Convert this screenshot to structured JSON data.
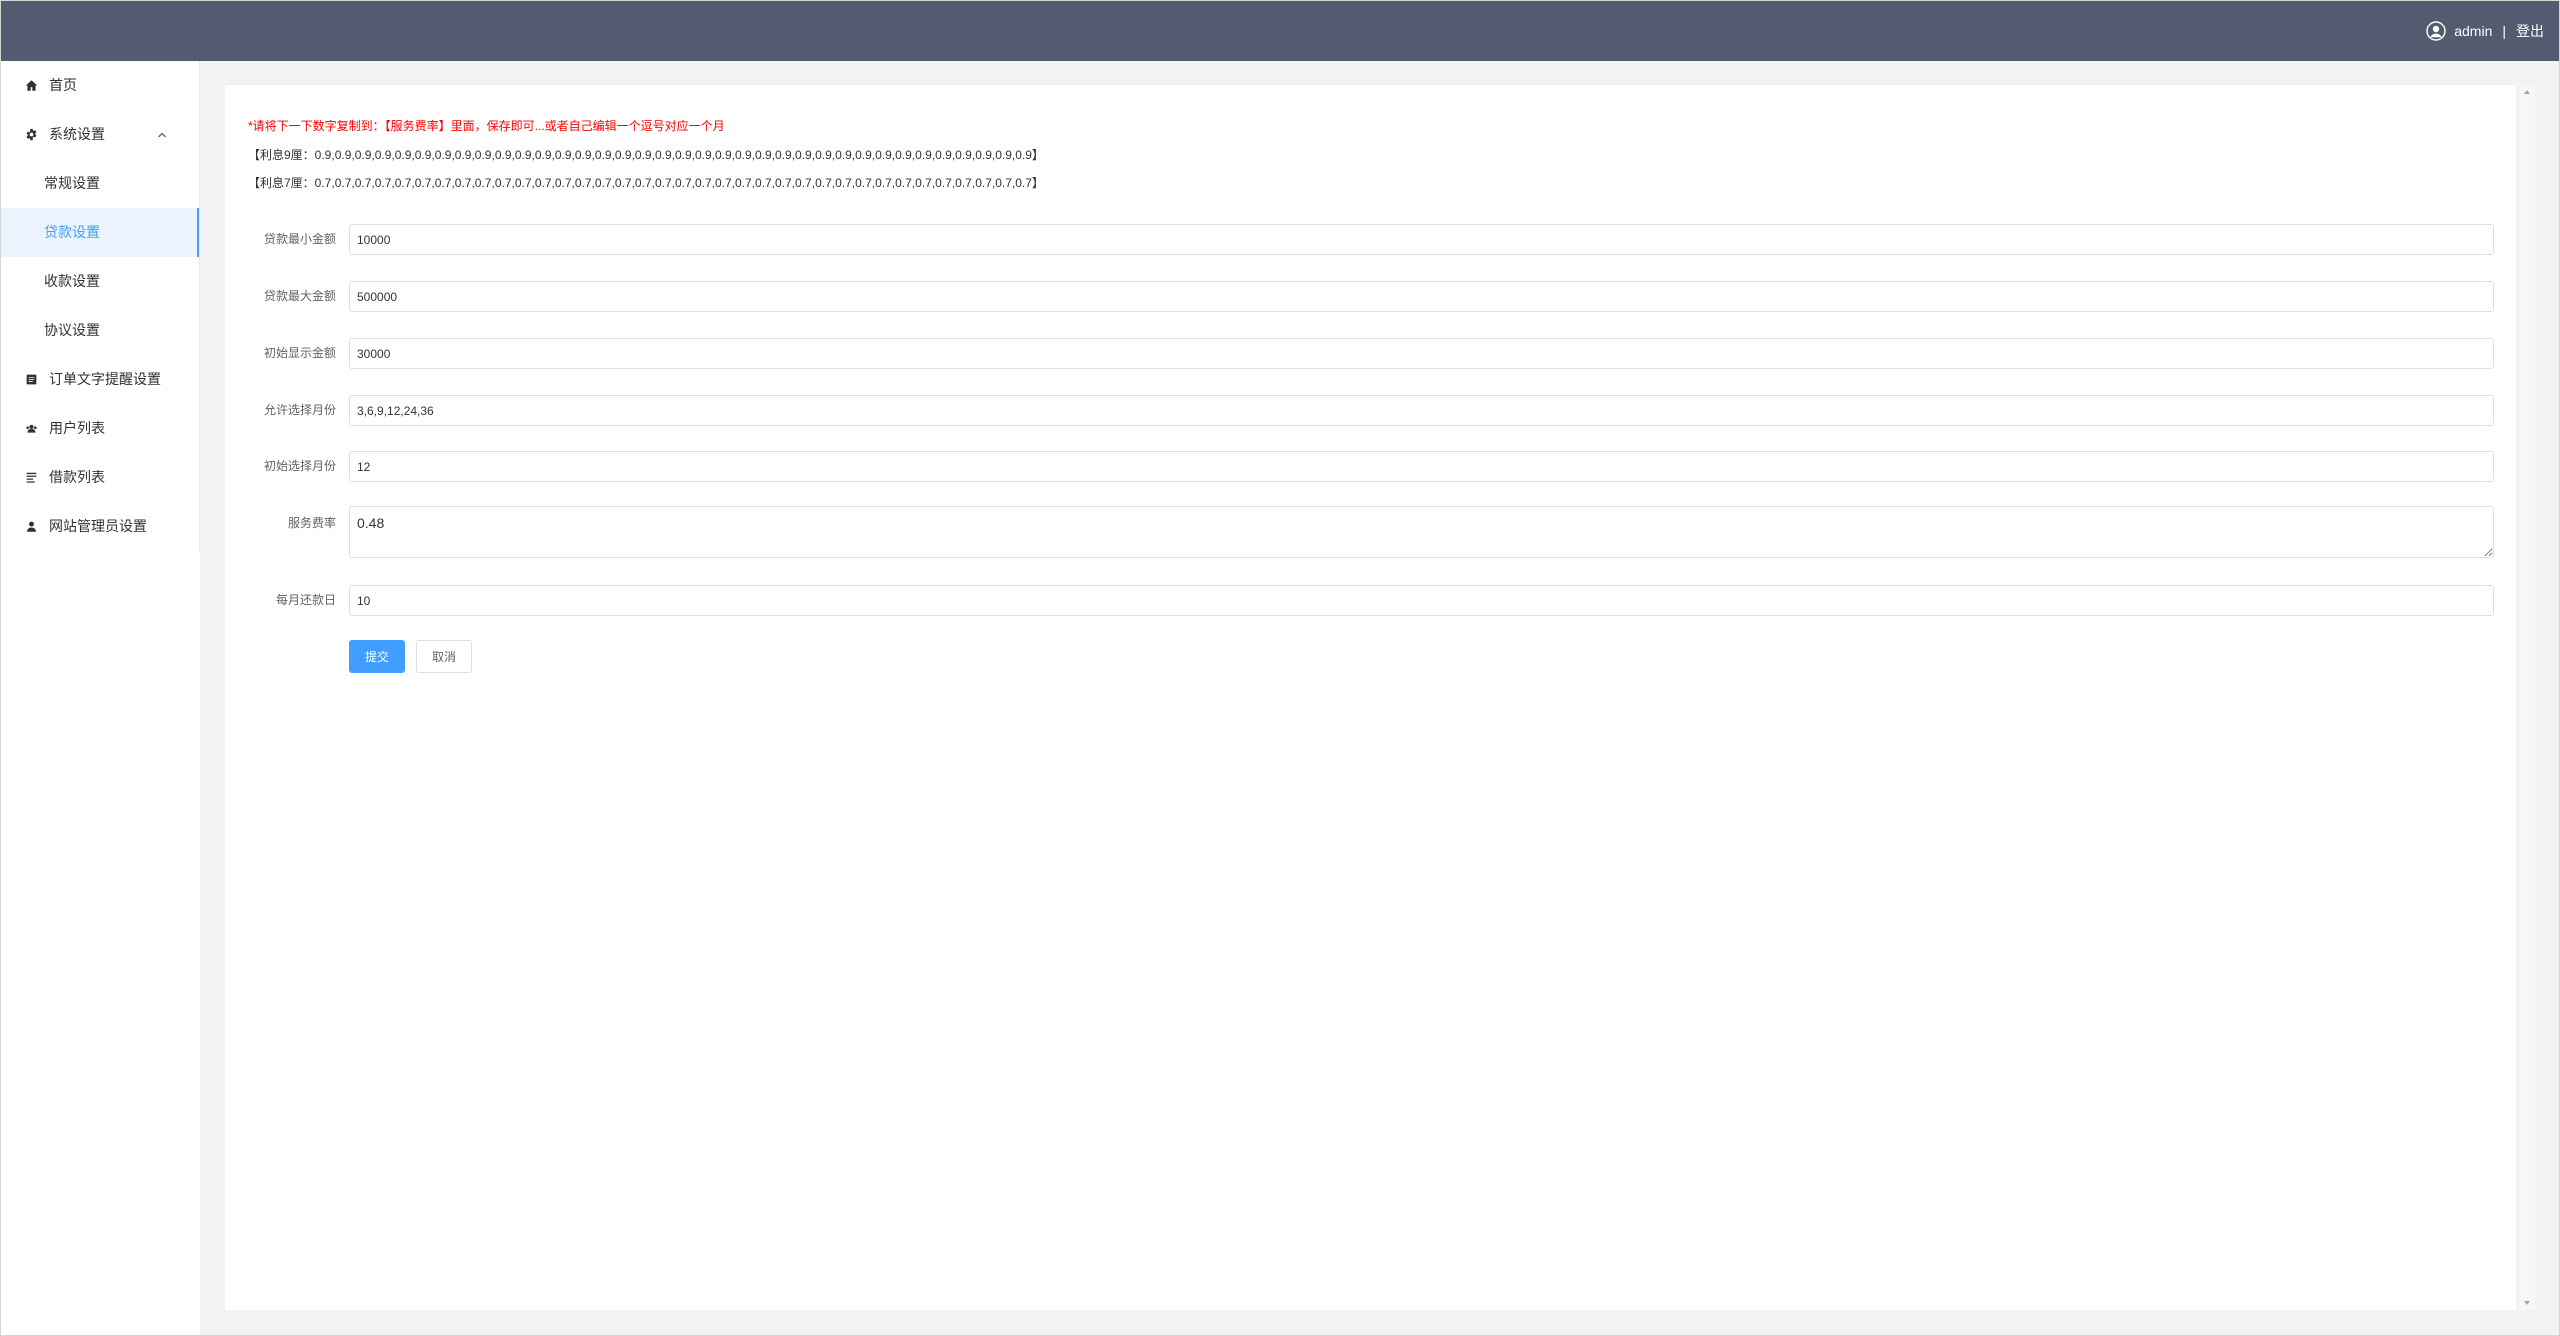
{
  "header": {
    "username": "admin",
    "separator": "|",
    "logout": "登出"
  },
  "sidebar": {
    "items": [
      {
        "label": "首页",
        "icon": "home-icon"
      },
      {
        "label": "系统设置",
        "icon": "gear-icon",
        "expanded": true,
        "children": [
          {
            "label": "常规设置"
          },
          {
            "label": "贷款设置",
            "active": true
          },
          {
            "label": "收款设置"
          },
          {
            "label": "协议设置"
          }
        ]
      },
      {
        "label": "订单文字提醒设置",
        "icon": "document-icon"
      },
      {
        "label": "用户列表",
        "icon": "users-icon"
      },
      {
        "label": "借款列表",
        "icon": "list-icon"
      },
      {
        "label": "网站管理员设置",
        "icon": "user-icon"
      }
    ]
  },
  "notice": {
    "hint": "*请将下一下数字复制到：【服务费率】里面，保存即可...或者自己编辑一个逗号对应一个月",
    "rate9": "【利息9厘：0.9,0.9,0.9,0.9,0.9,0.9,0.9,0.9,0.9,0.9,0.9,0.9,0.9,0.9,0.9,0.9,0.9,0.9,0.9,0.9,0.9,0.9,0.9,0.9,0.9,0.9,0.9,0.9,0.9,0.9,0.9,0.9,0.9,0.9,0.9,0.9】",
    "rate7": "【利息7厘：0.7,0.7,0.7,0.7,0.7,0.7,0.7,0.7,0.7,0.7,0.7,0.7,0.7,0.7,0.7,0.7,0.7,0.7,0.7,0.7,0.7,0.7,0.7,0.7,0.7,0.7,0.7,0.7,0.7,0.7,0.7,0.7,0.7,0.7,0.7,0.7】"
  },
  "form": {
    "fields": [
      {
        "label": "贷款最小金额",
        "value": "10000"
      },
      {
        "label": "贷款最大金额",
        "value": "500000"
      },
      {
        "label": "初始显示金额",
        "value": "30000"
      },
      {
        "label": "允许选择月份",
        "value": "3,6,9,12,24,36"
      },
      {
        "label": "初始选择月份",
        "value": "12"
      },
      {
        "label": "服务费率",
        "value": "0.48"
      },
      {
        "label": "每月还款日",
        "value": "10"
      }
    ],
    "submit": "提交",
    "cancel": "取消"
  },
  "colors": {
    "header": "#535b70",
    "accent": "#409eff",
    "notice": "#ff0000",
    "active_bg": "#ecf5ff",
    "main_bg": "#f2f2f2"
  }
}
